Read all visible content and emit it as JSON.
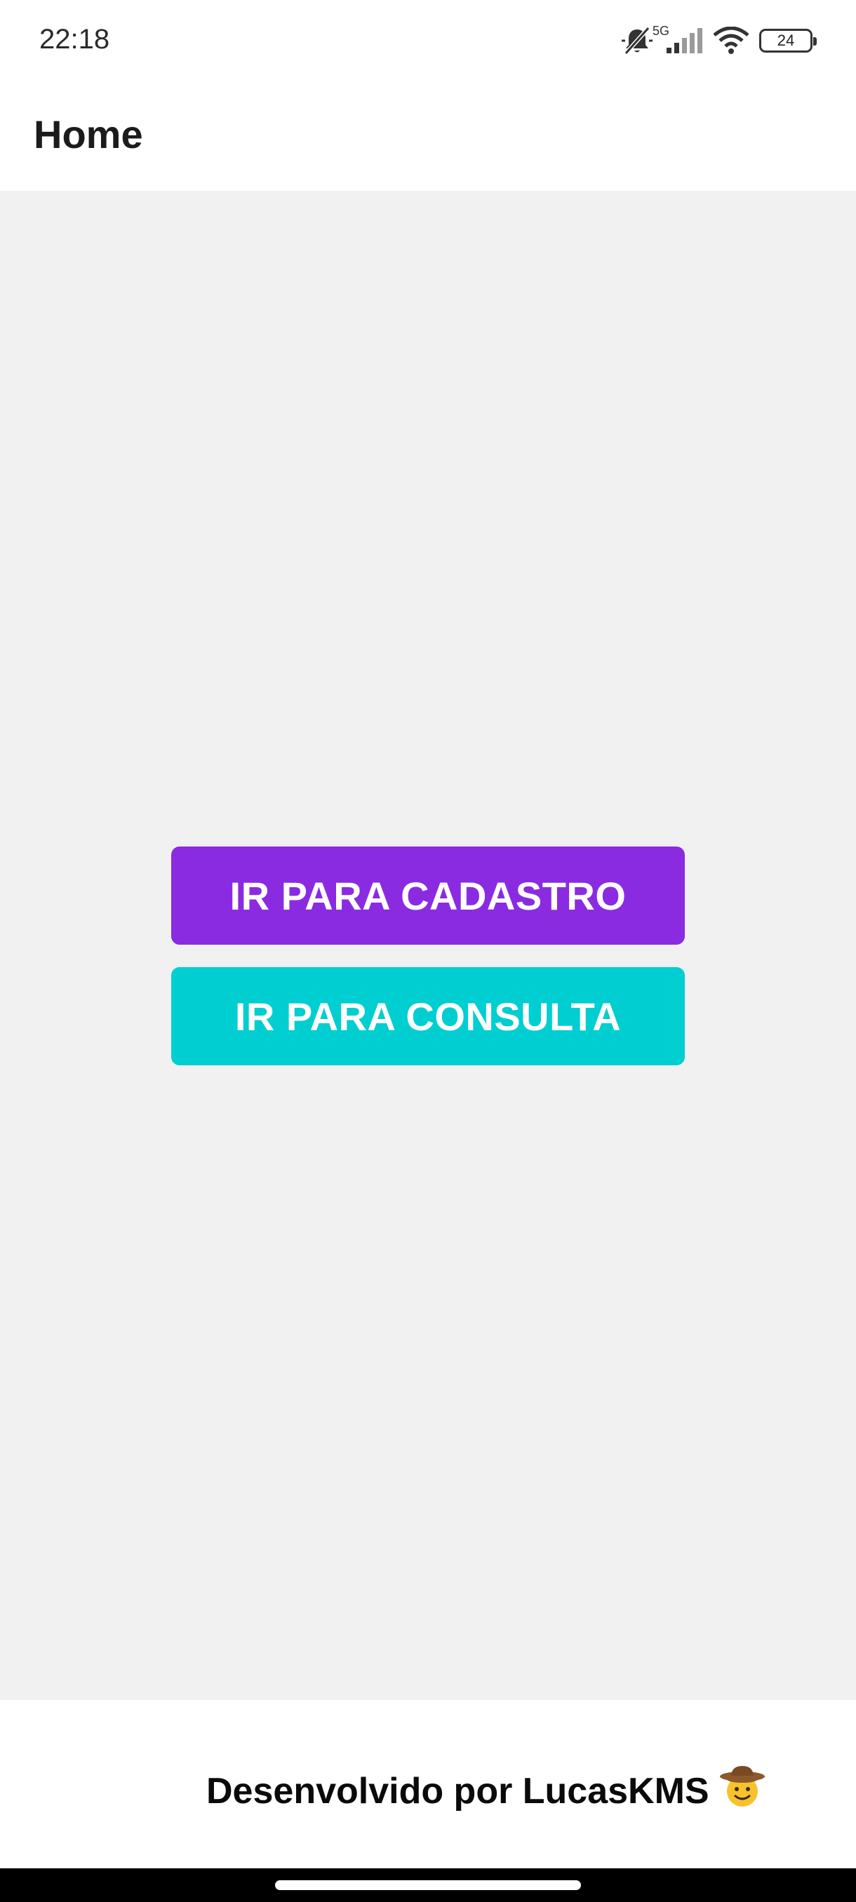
{
  "status_bar": {
    "time": "22:18",
    "network": "5G",
    "battery": "24",
    "icons": [
      "muted-bell-icon",
      "signal-icon",
      "wifi-icon",
      "battery-icon"
    ]
  },
  "app_bar": {
    "title": "Home"
  },
  "buttons": {
    "cadastro": {
      "label": "IR PARA CADASTRO",
      "color": "#8a2be2"
    },
    "consulta": {
      "label": "IR PARA CONSULTA",
      "color": "#00ced1"
    }
  },
  "footer": {
    "text": "Desenvolvido por LucasKMS",
    "emoji_icon": "cowboy-face-icon"
  },
  "colors": {
    "content_bg": "#f1f1f1",
    "nav_bar": "#000000"
  }
}
